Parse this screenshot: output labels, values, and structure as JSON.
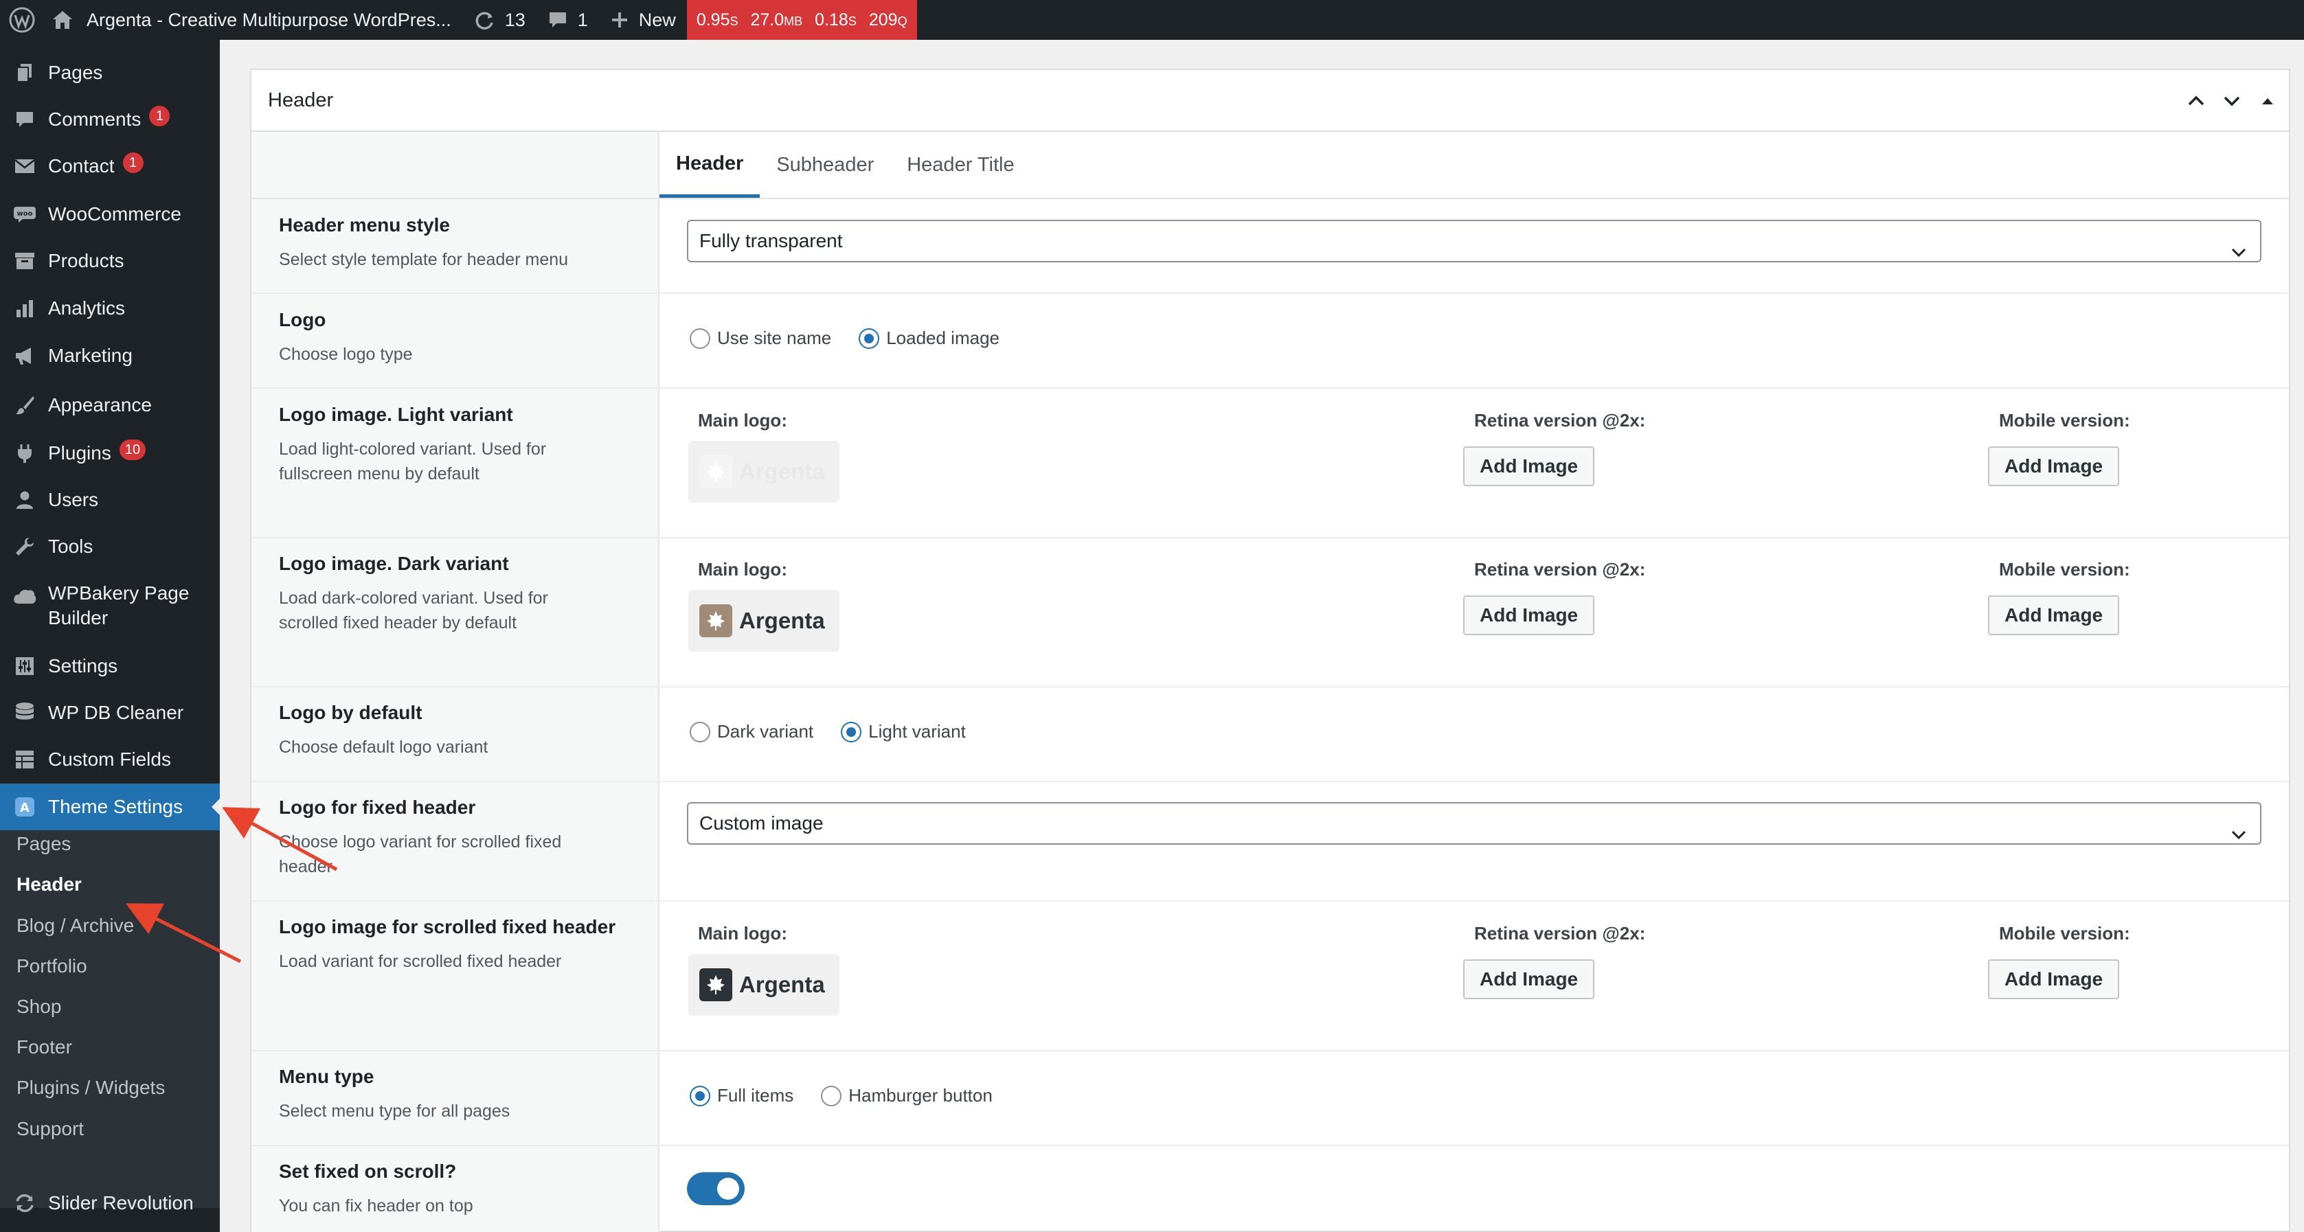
{
  "adminbar": {
    "site_title": "Argenta - Creative Multipurpose WordPres...",
    "updates_count": "13",
    "comments_count": "1",
    "new_label": "New",
    "perf": {
      "time1": "0.95",
      "mem": "27.0",
      "time2": "0.18",
      "queries": "209",
      "u_s": "S",
      "u_mb": "MB",
      "u_q": "Q"
    }
  },
  "sidebar": {
    "menu": [
      {
        "label": "Pages",
        "icon": "pages-icon"
      },
      {
        "label": "Comments",
        "icon": "comments-icon",
        "badge": "1"
      },
      {
        "label": "Contact",
        "icon": "mail-icon",
        "badge": "1"
      },
      {
        "label": "WooCommerce",
        "icon": "woocommerce-icon"
      },
      {
        "label": "Products",
        "icon": "archive-icon"
      },
      {
        "label": "Analytics",
        "icon": "chart-bar-icon"
      },
      {
        "label": "Marketing",
        "icon": "megaphone-icon"
      },
      {
        "label": "Appearance",
        "icon": "paintbrush-icon"
      },
      {
        "label": "Plugins",
        "icon": "plugin-icon",
        "badge": "10"
      },
      {
        "label": "Users",
        "icon": "user-icon"
      },
      {
        "label": "Tools",
        "icon": "wrench-icon"
      },
      {
        "label": "WPBakery Page",
        "label2": "Builder",
        "icon": "cloud-icon"
      },
      {
        "label": "Settings",
        "icon": "sliders-icon"
      },
      {
        "label": "WP DB Cleaner",
        "icon": "database-icon"
      },
      {
        "label": "Custom Fields",
        "icon": "grid-icon"
      },
      {
        "label": "Theme Settings",
        "icon": "theme-a-icon"
      },
      {
        "label": "Slider Revolution",
        "icon": "refresh-icon"
      }
    ],
    "submenu": [
      "Pages",
      "Header",
      "Blog / Archive",
      "Portfolio",
      "Shop",
      "Footer",
      "Plugins / Widgets",
      "Support"
    ]
  },
  "panel": {
    "title": "Header",
    "tabs": [
      "Header",
      "Subheader",
      "Header Title"
    ]
  },
  "fields": {
    "menu_style": {
      "title": "Header menu style",
      "desc": "Select style template for header menu",
      "value": "Fully transparent"
    },
    "logo": {
      "title": "Logo",
      "desc": "Choose logo type",
      "opt1": "Use site name",
      "opt2": "Loaded image",
      "selected": "Loaded image"
    },
    "logo_light": {
      "title": "Logo image. Light variant",
      "desc1": "Load light-colored variant. Used for",
      "desc2": "fullscreen menu by default"
    },
    "logo_dark": {
      "title": "Logo image. Dark variant",
      "desc1": "Load dark-colored variant. Used for",
      "desc2": "scrolled fixed header by default"
    },
    "logo_default": {
      "title": "Logo by default",
      "desc": "Choose default logo variant",
      "opt1": "Dark variant",
      "opt2": "Light variant",
      "selected": "Light variant"
    },
    "logo_fixed": {
      "title": "Logo for fixed header",
      "desc1": "Choose logo variant for scrolled fixed",
      "desc2": "header",
      "value": "Custom image"
    },
    "logo_scrolled": {
      "title": "Logo image for scrolled fixed header",
      "desc": "Load variant for scrolled fixed header"
    },
    "menu_type": {
      "title": "Menu type",
      "desc": "Select menu type for all pages",
      "opt1": "Full items",
      "opt2": "Hamburger button",
      "selected": "Full items"
    },
    "fixed_scroll": {
      "title": "Set fixed on scroll?",
      "desc": "You can fix header on top",
      "enabled": true
    }
  },
  "uploads": {
    "main_logo": "Main logo:",
    "retina": "Retina version @2x:",
    "mobile": "Mobile version:",
    "add_image": "Add Image",
    "logo_text": "Argenta"
  },
  "colors": {
    "accent": "#2271b1",
    "adminbar": "#1d2327",
    "badge": "#d63638",
    "annotation_arrow": "#e8432d"
  }
}
